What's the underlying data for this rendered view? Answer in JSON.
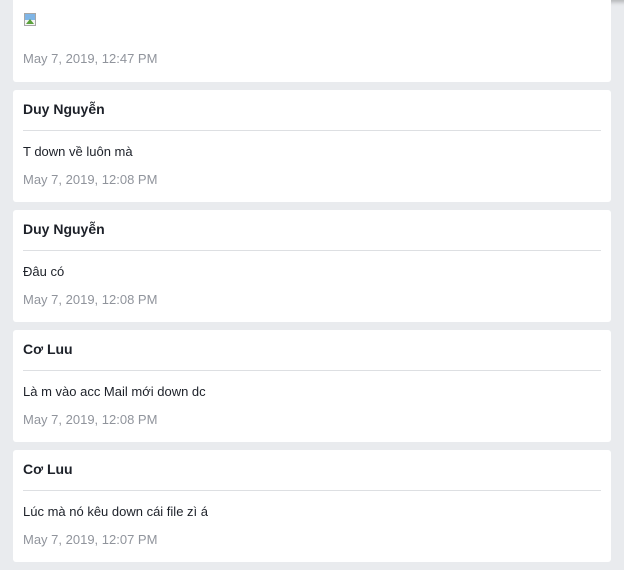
{
  "first_post": {
    "image_icon": "broken-image-icon",
    "timestamp": "May 7, 2019, 12:47 PM"
  },
  "messages": [
    {
      "sender": "Duy Nguyễn",
      "text": "T down về luôn mà",
      "timestamp": "May 7, 2019, 12:08 PM"
    },
    {
      "sender": "Duy Nguyễn",
      "text": "Đâu có",
      "timestamp": "May 7, 2019, 12:08 PM"
    },
    {
      "sender": "Cơ Luu",
      "text": "Là m vào acc Mail mới down dc",
      "timestamp": "May 7, 2019, 12:08 PM"
    },
    {
      "sender": "Cơ Luu",
      "text": "Lúc mà nó kêu down cái file zì á",
      "timestamp": "May 7, 2019, 12:07 PM"
    }
  ],
  "colors": {
    "page_background": "#e9ebee",
    "card_background": "#ffffff",
    "timestamp_text": "#90949c",
    "divider": "#dddfe2"
  }
}
